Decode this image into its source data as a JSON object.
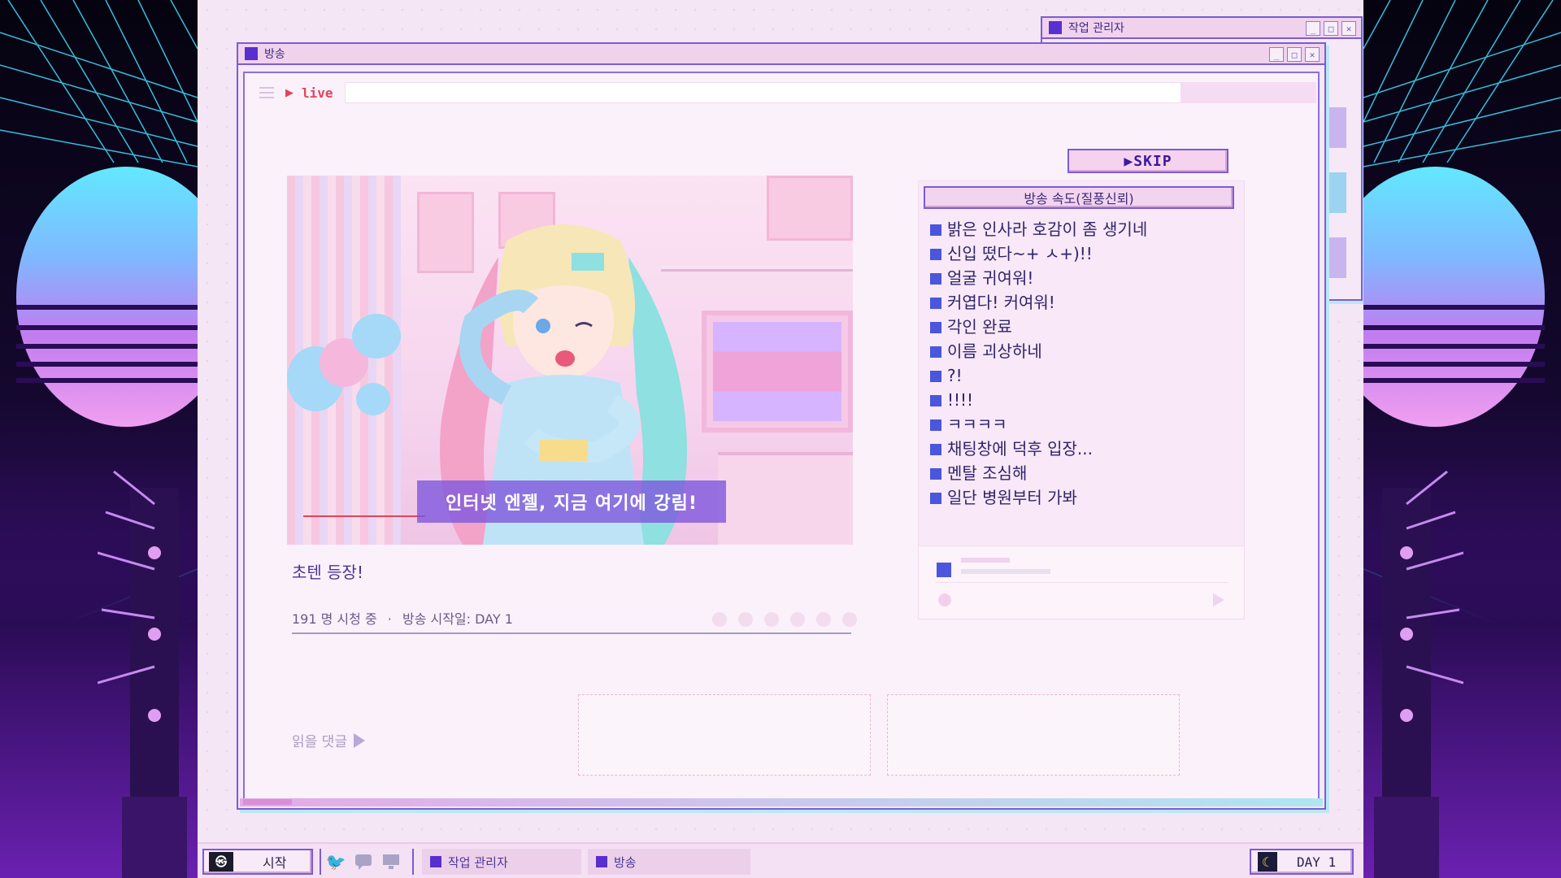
{
  "desktop": {
    "task_manager_title": "작업 관리자",
    "broadcast_title": "방송"
  },
  "window_controls": {
    "minimize": "_",
    "maximize": "□",
    "close": "✕"
  },
  "browser": {
    "live_label": "live",
    "skip_label": "▶SKIP"
  },
  "stream": {
    "caption": "인터넷 엔젤, 지금 여기에 강림!",
    "title": "초텐 등장!",
    "viewers": "191 명 시청 중",
    "separator": "·",
    "start_date": "방송 시작일: DAY 1",
    "read_comments": "읽을 댓글"
  },
  "chat": {
    "header": "방송 속도(질풍신뢰)",
    "messages": [
      "밝은 인사라 호감이 좀 생기네",
      "신입 떴다~+ ㅅ+)!!",
      "얼굴 귀여워!",
      "커엽다! 커여워!",
      "각인 완료",
      "이름 괴상하네",
      "?!",
      "!!!!",
      "ㅋㅋㅋㅋ",
      "채팅창에 덕후 입장...",
      "멘탈 조심해",
      "일단 병원부터 가봐"
    ]
  },
  "taskbar": {
    "start_label": "시작",
    "tasks": [
      "작업 관리자",
      "방송"
    ],
    "day_label": "DAY 1"
  },
  "colors": {
    "accent": "#7b5cd6",
    "window_bg": "#f6e8f6",
    "chat_bullet": "#4a56dc",
    "live_red": "#e0445c"
  },
  "icons": [
    "menu-icon",
    "play-icon",
    "twitter-icon",
    "chat-bubble-icon",
    "monitor-icon",
    "moon-icon"
  ]
}
